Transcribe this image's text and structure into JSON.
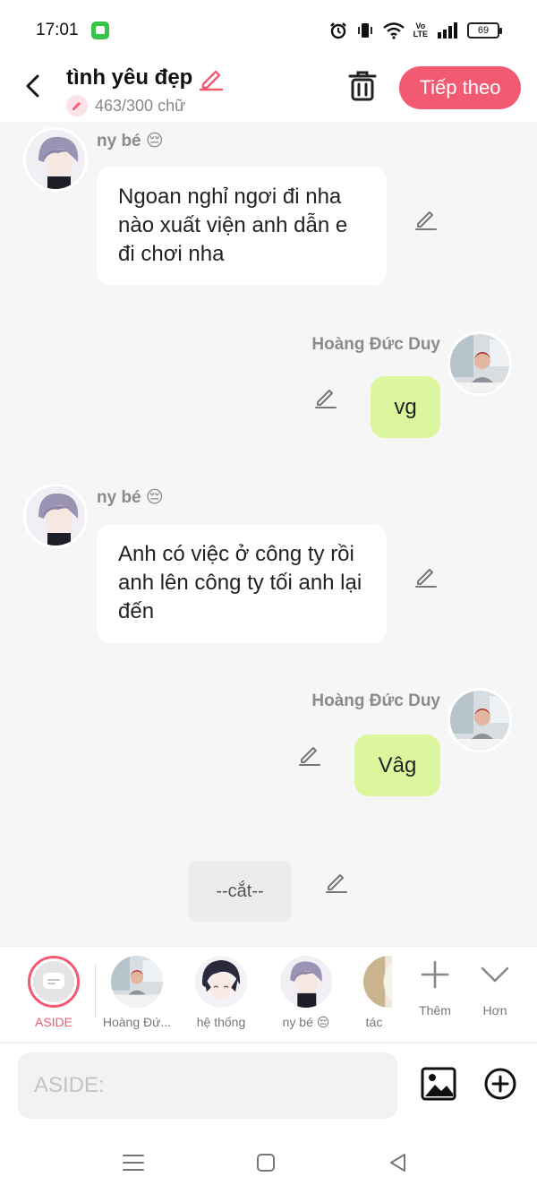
{
  "status_bar": {
    "time": "17:01",
    "battery": "69",
    "volte_top": "Vo",
    "volte_bottom": "LTE"
  },
  "header": {
    "title": "tình yêu đẹp",
    "word_count": "463/300 chữ",
    "next_label": "Tiếp theo"
  },
  "messages": [
    {
      "side": "left",
      "sender": "ny bé 😔",
      "text": "Ngoan nghỉ ngơi đi nha nào xuất viện anh dẫn e đi chơi nha"
    },
    {
      "side": "right",
      "sender": "Hoàng Đức Duy",
      "text": "vg"
    },
    {
      "side": "left",
      "sender": "ny bé 😔",
      "text": "Anh có việc ở công ty rồi anh lên công ty tối anh lại đến"
    },
    {
      "side": "right",
      "sender": "Hoàng Đức Duy",
      "text": "Vâg"
    }
  ],
  "cut_marker": "--cắt--",
  "characters": [
    {
      "label": "ASIDE"
    },
    {
      "label": "Hoàng Đứ..."
    },
    {
      "label": "hệ thống"
    },
    {
      "label": "ny bé 😔"
    },
    {
      "label": "tác"
    }
  ],
  "tools": {
    "add_label": "Thêm",
    "more_label": "Hơn"
  },
  "composer": {
    "placeholder": "ASIDE:"
  },
  "colors": {
    "accent": "#f25a71",
    "right_bubble": "#dbf69c",
    "background": "#f6f6f6"
  },
  "icons": [
    "back-arrow-icon",
    "pencil-icon",
    "trash-icon",
    "edit-icon",
    "plus-icon",
    "chevron-down-icon",
    "image-icon",
    "add-circle-icon",
    "menu-icon",
    "home-square-icon",
    "back-triangle-icon"
  ]
}
